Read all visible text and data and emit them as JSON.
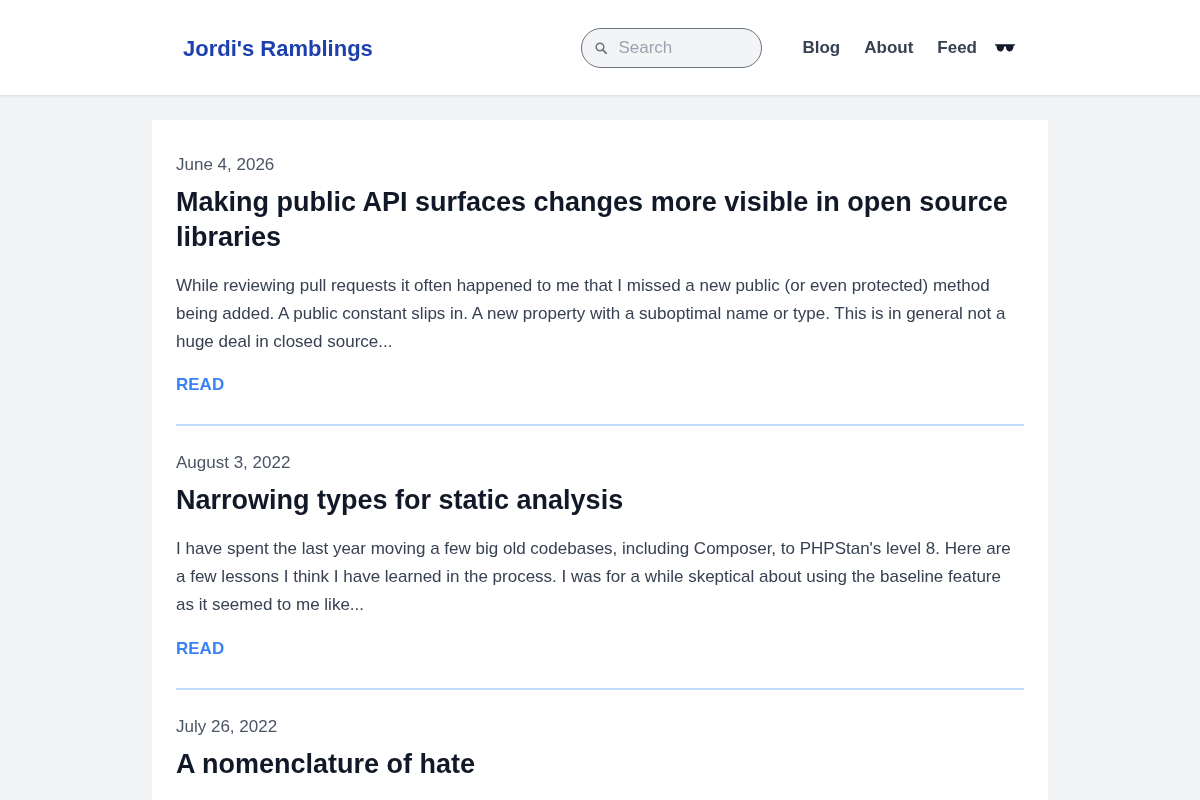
{
  "header": {
    "site_title": "Jordi's Ramblings",
    "search": {
      "placeholder": "Search"
    },
    "nav": [
      {
        "label": "Blog"
      },
      {
        "label": "About"
      },
      {
        "label": "Feed"
      }
    ]
  },
  "posts": [
    {
      "date": "June 4, 2026",
      "title": "Making public API surfaces changes more visible in open source libraries",
      "excerpt": "While reviewing pull requests it often happened to me that I missed a new public (or even protected) method being added. A public constant slips in. A new property with a suboptimal name or type. This is in general not a huge deal in closed source...",
      "link": "READ"
    },
    {
      "date": "August 3, 2022",
      "title": "Narrowing types for static analysis",
      "excerpt": "I have spent the last year moving a few big old codebases, including Composer, to PHPStan's level 8. Here are a few lessons I think I have learned in the process. I was for a while skeptical about using the baseline feature as it seemed to me like...",
      "link": "READ"
    },
    {
      "date": "July 26, 2022",
      "title": "A nomenclature of hate"
    }
  ]
}
